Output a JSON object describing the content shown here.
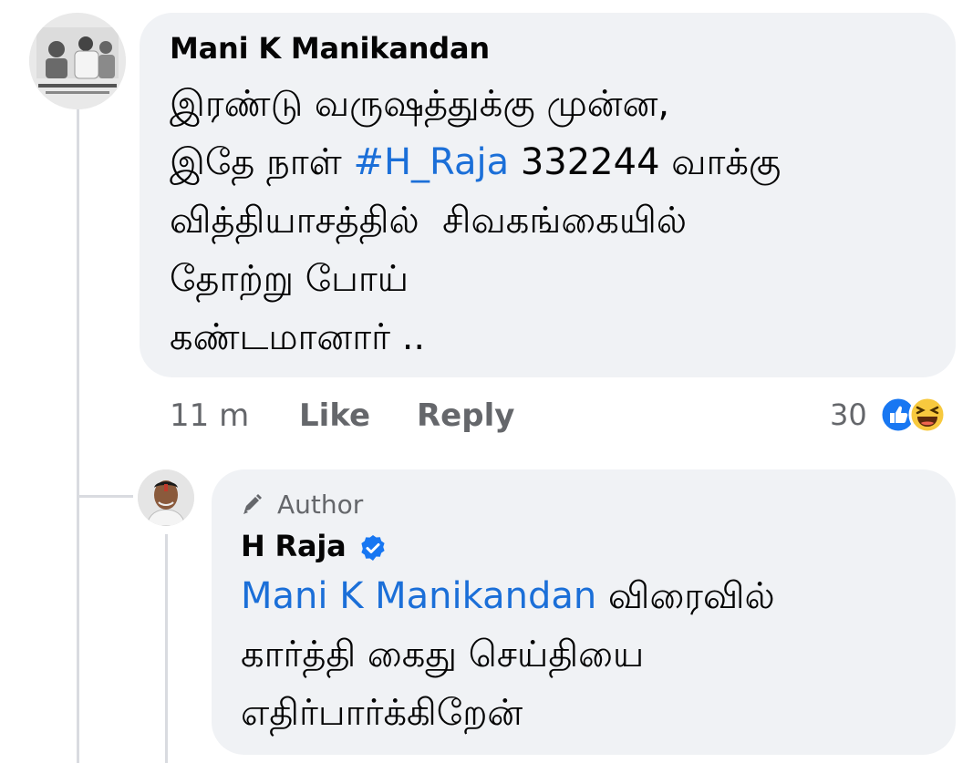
{
  "comment": {
    "author": "Mani K Manikandan",
    "lines": [
      {
        "text": "இரண்டு வருஷத்துக்கு முன்ன,"
      },
      {
        "before": "இதே நாள் ",
        "tag": "#H_Raja",
        "after": " 332244 வாக்கு"
      },
      {
        "text": "வித்தியாசத்தில்  சிவகங்கையில்"
      },
      {
        "text": "தோற்று போய்"
      },
      {
        "text": "கண்டமானார் .."
      }
    ],
    "time": "11 m",
    "like_label": "Like",
    "reply_label": "Reply",
    "reaction_count": "30",
    "reaction_icons": [
      "like-icon",
      "haha-icon"
    ]
  },
  "reply": {
    "badge_label": "Author",
    "badge_icon": "pencil-icon",
    "author": "H Raja",
    "verified_icon": "verified-check-icon",
    "mention": "Mani K Manikandan",
    "line1_rest": " விரைவில்",
    "line2": "கார்த்தி கைது செய்தியை",
    "line3": "எதிர்பார்க்கிறேன்"
  },
  "colors": {
    "bubble": "#f0f2f5",
    "link": "#1b6fd8",
    "secondary_text": "#65676b",
    "verified": "#1877f2"
  }
}
